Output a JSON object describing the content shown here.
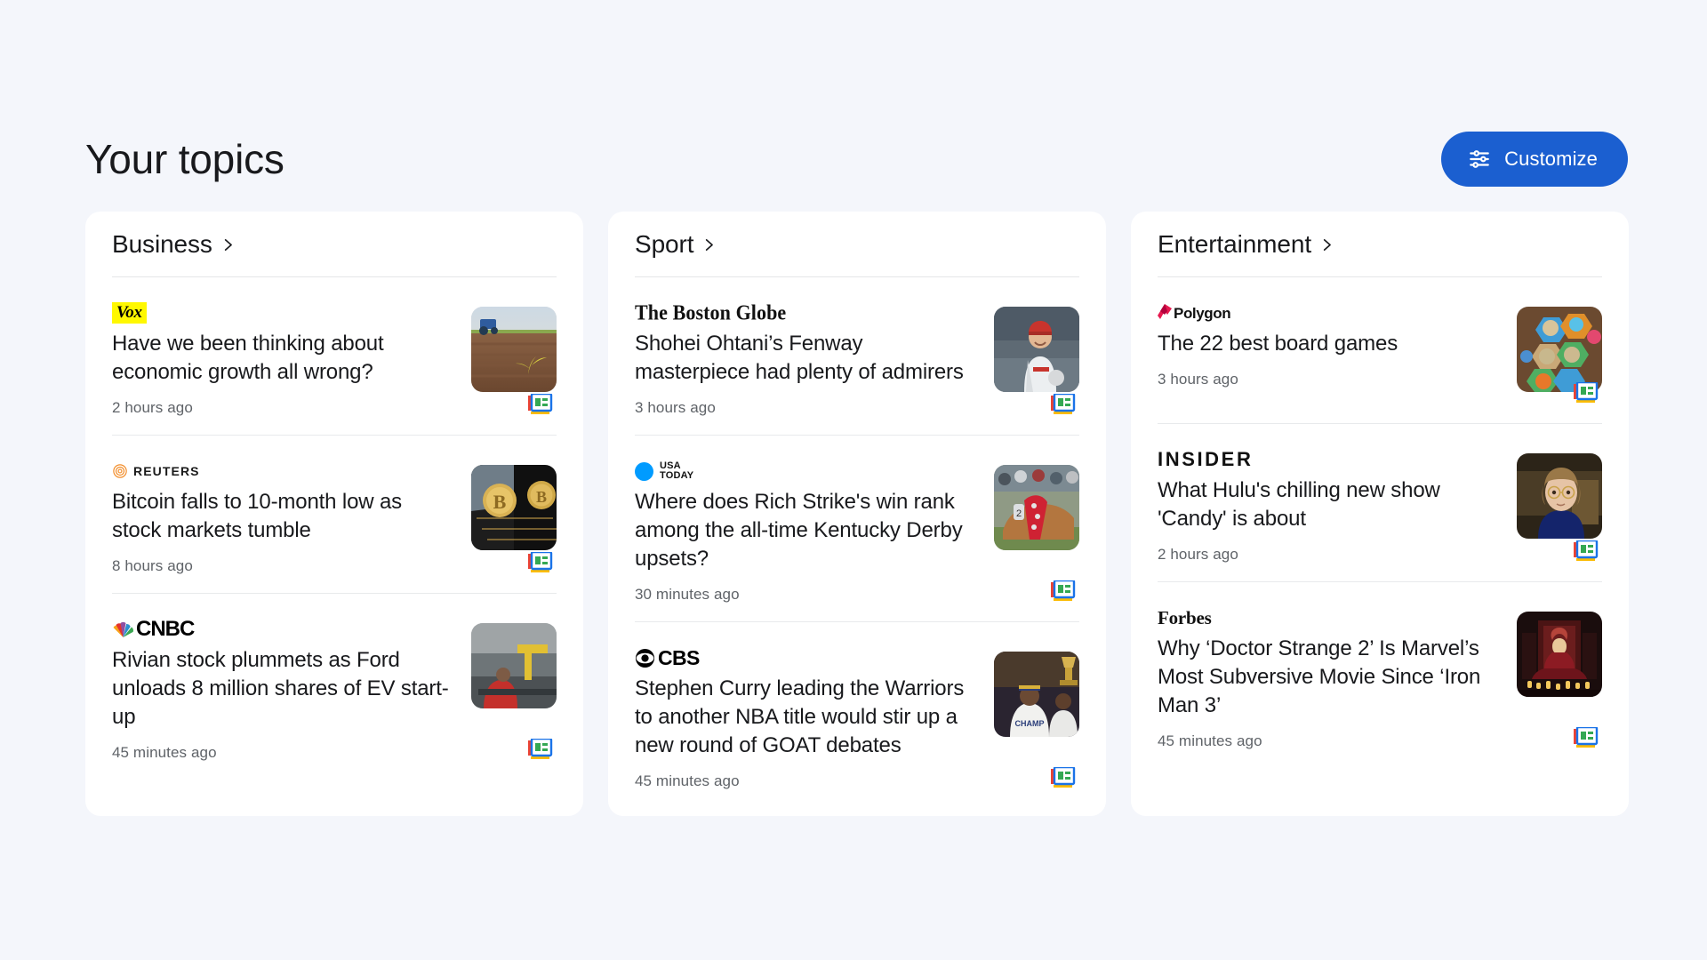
{
  "header": {
    "title": "Your topics",
    "customize_label": "Customize",
    "customize_icon": "tune-icon",
    "accent_color": "#1b5fd0"
  },
  "page": {
    "background_color": "#f4f6fb",
    "card_color": "#ffffff",
    "divider_color": "#e8eaec",
    "headline_color": "#18191c",
    "timestamp_color": "#5f6368"
  },
  "columns": [
    {
      "topic": "Business",
      "chevron_icon": "chevron-right-icon",
      "articles": [
        {
          "source": "Vox",
          "source_logo": "vox-logo",
          "headline": "Have we been thinking about economic growth all wrong?",
          "timestamp": "2 hours ago",
          "thumbnail": "tractor-field-seedling-photo",
          "full_coverage_icon": "full-coverage-icon"
        },
        {
          "source": "REUTERS",
          "source_logo": "reuters-logo",
          "headline": "Bitcoin falls to 10-month low as stock markets tumble",
          "timestamp": "8 hours ago",
          "thumbnail": "bitcoin-coins-photo",
          "full_coverage_icon": "full-coverage-icon"
        },
        {
          "source": "CNBC",
          "source_logo": "cnbc-logo",
          "headline": "Rivian stock plummets as Ford unloads 8 million shares of EV start-up",
          "timestamp": "45 minutes ago",
          "thumbnail": "ev-factory-worker-photo",
          "full_coverage_icon": "full-coverage-icon"
        }
      ]
    },
    {
      "topic": "Sport",
      "chevron_icon": "chevron-right-icon",
      "articles": [
        {
          "source": "The Boston Globe",
          "source_logo": "boston-globe-logo",
          "headline": "Shohei Ohtani’s Fenway masterpiece had plenty of admirers",
          "timestamp": "3 hours ago",
          "thumbnail": "baseball-pitcher-angels-photo",
          "full_coverage_icon": "full-coverage-icon"
        },
        {
          "source": "USA TODAY",
          "source_logo": "usa-today-logo",
          "source_line1": "USA",
          "source_line2": "TODAY",
          "headline": "Where does Rich Strike's win rank among the all-time Kentucky Derby upsets?",
          "timestamp": "30 minutes ago",
          "thumbnail": "kentucky-derby-horse-roses-photo",
          "full_coverage_icon": "full-coverage-icon"
        },
        {
          "source": "CBS",
          "source_logo": "cbs-logo",
          "headline": "Stephen Curry leading the Warriors to another NBA title would stir up a new round of GOAT debates",
          "timestamp": "45 minutes ago",
          "thumbnail": "warriors-trophy-celebration-photo",
          "full_coverage_icon": "full-coverage-icon"
        }
      ]
    },
    {
      "topic": "Entertainment",
      "chevron_icon": "chevron-right-icon",
      "articles": [
        {
          "source": "Polygon",
          "source_logo": "polygon-logo",
          "headline": "The 22 best board games",
          "timestamp": "3 hours ago",
          "thumbnail": "board-game-hex-tiles-photo",
          "full_coverage_icon": "full-coverage-icon"
        },
        {
          "source": "INSIDER",
          "source_logo": "insider-logo",
          "headline": "What Hulu's chilling new show 'Candy' is about",
          "timestamp": "2 hours ago",
          "thumbnail": "woman-glasses-blue-blouse-photo",
          "full_coverage_icon": "full-coverage-icon"
        },
        {
          "source": "Forbes",
          "source_logo": "forbes-logo",
          "headline": "Why ‘Doctor Strange 2’ Is Marvel’s Most Subversive Movie Since ‘Iron Man 3’",
          "timestamp": "45 minutes ago",
          "thumbnail": "scarlet-witch-candles-photo",
          "full_coverage_icon": "full-coverage-icon"
        }
      ]
    }
  ]
}
